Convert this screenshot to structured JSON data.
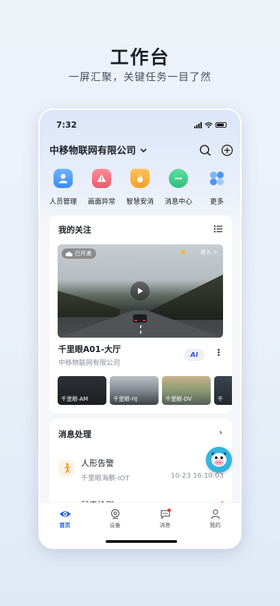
{
  "promo": {
    "title": "工作台",
    "subtitle": "一屏汇聚，关键任务一目了然"
  },
  "status_bar": {
    "time": "7:32"
  },
  "header": {
    "company": "中移物联网有限公司"
  },
  "quick_actions": [
    {
      "label": "人员管理",
      "icon": "person-icon",
      "color": "#3b8cf6"
    },
    {
      "label": "画面异常",
      "icon": "warning-monitor-icon",
      "color": "#ef5b6a"
    },
    {
      "label": "智慧安消",
      "icon": "fire-shield-icon",
      "color": "#f5a024"
    },
    {
      "label": "消息中心",
      "icon": "chat-icon",
      "color": "#2fc17c"
    },
    {
      "label": "更多",
      "icon": "grid-icon",
      "color": "#5aa0f5"
    }
  ],
  "focus": {
    "title": "我的关注",
    "badge": "已开通",
    "enter_label": "进入 >",
    "camera_name": "千里眼A01-大厅",
    "camera_org": "中移物联网有限公司",
    "ai_label": "AI",
    "thumbnails": [
      "千里眼-AM",
      "千里眼-HJ",
      "千里眼-DV",
      "千"
    ]
  },
  "messages": {
    "title": "消息处理",
    "items": [
      {
        "title": "人形告警",
        "source": "千里眼海鹏-IOT",
        "time": "10-23 16:10:03"
      },
      {
        "title": "鼠患检测"
      }
    ]
  },
  "tabbar": [
    {
      "label": "首页",
      "active": true
    },
    {
      "label": "设备",
      "active": false
    },
    {
      "label": "消息",
      "active": false
    },
    {
      "label": "我的",
      "active": false
    }
  ]
}
